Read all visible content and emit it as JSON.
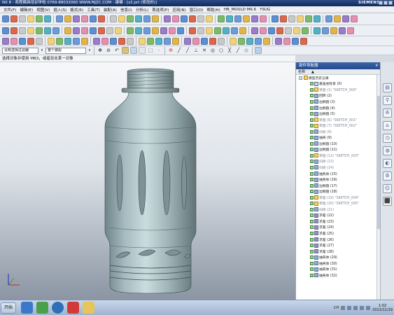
{
  "window": {
    "title": "NX 8 - 凯程模具培训学校 0769-88032060 WWW.MJZC.COM - 建模 - [z2.prt (修改的)]",
    "brand": "SIEMENS"
  },
  "menu": [
    "文件(F)",
    "编辑(E)",
    "视图(V)",
    "插入(S)",
    "格式(R)",
    "工具(T)",
    "装配(A)",
    "信息(I)",
    "分析(L)",
    "首选项(P)",
    "应用(N)",
    "窗口(O)",
    "帮助(H)",
    "HB_MOULD M6.6",
    "YSUG"
  ],
  "filters": {
    "selection_scope": "没有选择过滤器",
    "assembly_scope": "整个装配"
  },
  "status_prompt": "选择对象并使用 MB3，或者双击某一对象",
  "navigator": {
    "title": "部件导航器",
    "column": "名称",
    "sort_glyph": "▲",
    "root": "模型历史记录",
    "items": [
      {
        "label": "基准坐标系 (0)",
        "icon": "cs",
        "dim": false
      },
      {
        "label": "草图 (1) \"SKETCH_000\"",
        "icon": "sk",
        "dim": true
      },
      {
        "label": "回转 (2)",
        "icon": "bl",
        "dim": false
      },
      {
        "label": "边倒圆 (3)",
        "icon": "bl",
        "dim": false
      },
      {
        "label": "边倒圆 (4)",
        "icon": "bl",
        "dim": false
      },
      {
        "label": "边倒圆 (5)",
        "icon": "bl",
        "dim": false
      },
      {
        "label": "草图 (6) \"SKETCH_001\"",
        "icon": "sk",
        "dim": true
      },
      {
        "label": "草图 (7) \"SKETCH_002\"",
        "icon": "sk",
        "dim": true
      },
      {
        "label": "扫掠 (8)",
        "icon": "bl",
        "dim": true
      },
      {
        "label": "抽壳 (9)",
        "icon": "bl",
        "dim": false
      },
      {
        "label": "边倒圆 (10)",
        "icon": "bl",
        "dim": false
      },
      {
        "label": "边倒圆 (11)",
        "icon": "bl",
        "dim": false
      },
      {
        "label": "草图 (12) \"SKETCH_003\"",
        "icon": "sk",
        "dim": true
      },
      {
        "label": "扫掠 (13)",
        "icon": "bl",
        "dim": true
      },
      {
        "label": "扫掠 (14)",
        "icon": "bl",
        "dim": true
      },
      {
        "label": "抽壳体 (15)",
        "icon": "bl",
        "dim": false
      },
      {
        "label": "抽壳体 (16)",
        "icon": "bl",
        "dim": false
      },
      {
        "label": "边倒圆 (17)",
        "icon": "bl",
        "dim": false
      },
      {
        "label": "边倒圆 (18)",
        "icon": "bl",
        "dim": false
      },
      {
        "label": "草图 (19) \"SKETCH_004\"",
        "icon": "sk",
        "dim": true
      },
      {
        "label": "草图 (20) \"SKETCH_005\"",
        "icon": "sk",
        "dim": true
      },
      {
        "label": "扫掠 (21)",
        "icon": "bl",
        "dim": true
      },
      {
        "label": "求差 (22)",
        "icon": "ed",
        "dim": false
      },
      {
        "label": "求差 (23)",
        "icon": "ed",
        "dim": false
      },
      {
        "label": "求差 (24)",
        "icon": "ed",
        "dim": false
      },
      {
        "label": "求差 (25)",
        "icon": "ed",
        "dim": false
      },
      {
        "label": "求差 (26)",
        "icon": "ed",
        "dim": false
      },
      {
        "label": "求差 (27)",
        "icon": "ed",
        "dim": false
      },
      {
        "label": "求差 (28)",
        "icon": "ed",
        "dim": false
      },
      {
        "label": "抽壳体 (29)",
        "icon": "bl",
        "dim": false
      },
      {
        "label": "抽壳体 (30)",
        "icon": "bl",
        "dim": false
      },
      {
        "label": "抽壳体 (31)",
        "icon": "bl",
        "dim": false
      },
      {
        "label": "抽壳体 (32)",
        "icon": "bl",
        "dim": false
      }
    ]
  },
  "taskbar": {
    "start_label": "开始",
    "tray_lang": "CH",
    "time": "1:02",
    "date": "2012/11/19"
  },
  "colors": {
    "model": "#8fa5a9",
    "title_bar": "#1b3a72",
    "navigator_header": "#2f55a0"
  }
}
